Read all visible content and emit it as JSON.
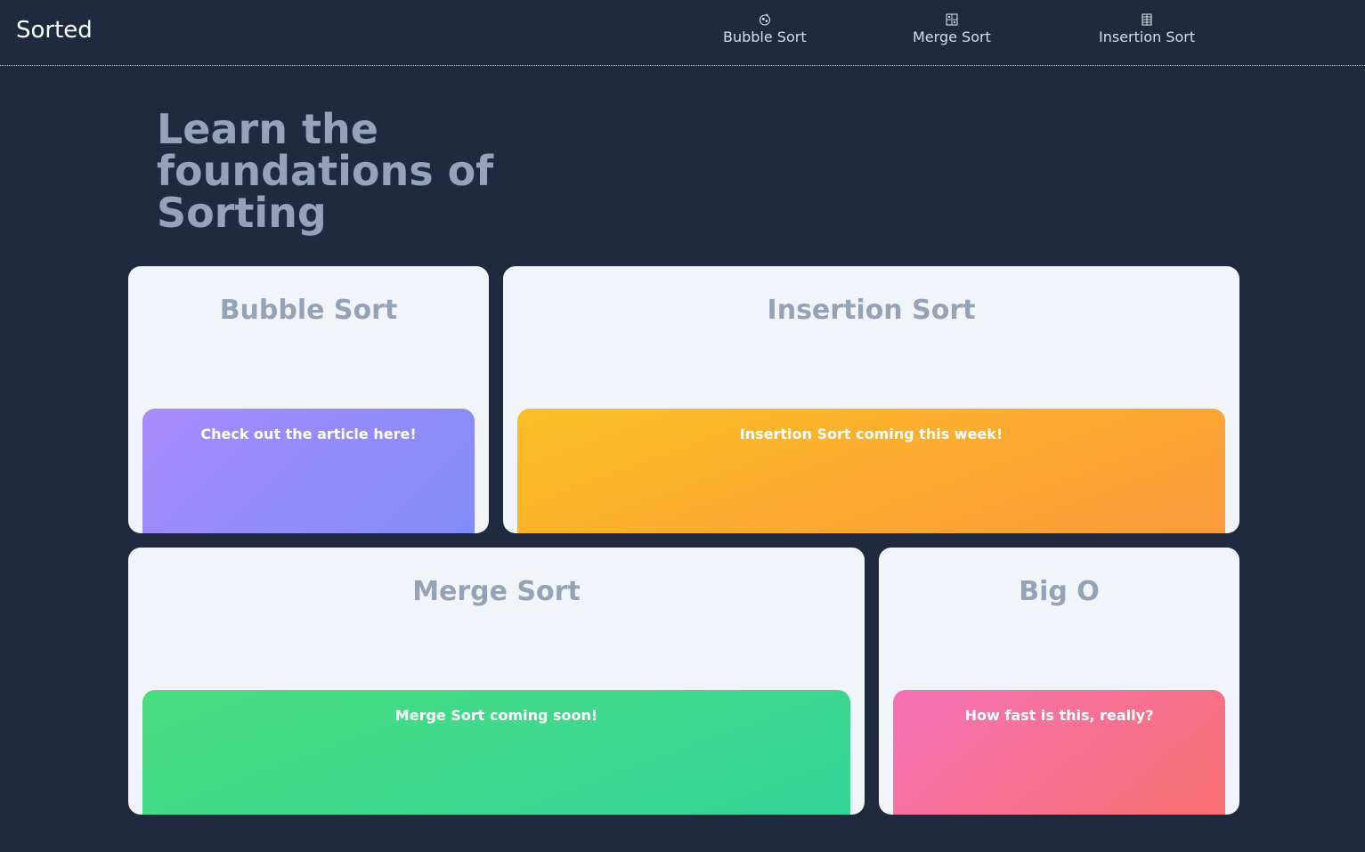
{
  "header": {
    "brand": "Sorted",
    "nav": [
      {
        "label": "Bubble Sort",
        "icon": "bubbles-icon"
      },
      {
        "label": "Merge Sort",
        "icon": "merge-icon"
      },
      {
        "label": "Insertion Sort",
        "icon": "grid-icon"
      }
    ]
  },
  "hero": {
    "title": "Learn the foundations of Sorting"
  },
  "cards": [
    {
      "title": "Bubble Sort",
      "panel_text": "Check out the article here!",
      "accent": "#a78bfa"
    },
    {
      "title": "Insertion Sort",
      "panel_text": "Insertion Sort coming this week!",
      "accent": "#fbbf24"
    },
    {
      "title": "Merge Sort",
      "panel_text": "Merge Sort coming soon!",
      "accent": "#4ade80"
    },
    {
      "title": "Big O",
      "panel_text": "How fast is this, really?",
      "accent": "#f472b6"
    }
  ],
  "colors": {
    "background": "#1f2a3e",
    "card": "#f1f5f9",
    "muted_text": "#94a3b8"
  }
}
